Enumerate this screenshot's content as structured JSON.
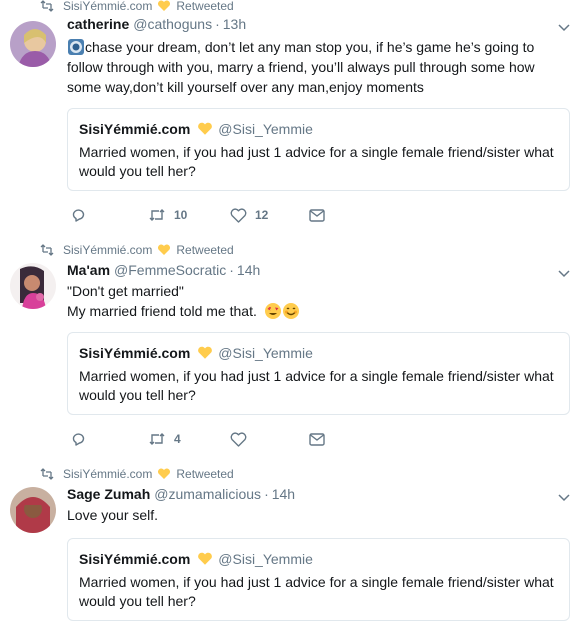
{
  "tweets": [
    {
      "retweeted_by": "SisiYémmié.com",
      "retweeted_label": "Retweeted",
      "name": "catherine",
      "handle": "@cathoguns",
      "time": "13h",
      "text": "chase your dream, don’t let any man stop you, if he’s game he’s going to follow through with you, marry a friend, you’ll always pull through some how some way,don’t kill yourself over any man,enjoy moments",
      "quote": {
        "name": "SisiYémmié.com",
        "handle": "@Sisi_Yemmie",
        "text": "Married women, if you had just 1 advice for a single female friend/sister what would you tell her?"
      },
      "actions": {
        "reply": "",
        "retweets": "10",
        "likes": "12"
      }
    },
    {
      "retweeted_by": "SisiYémmié.com",
      "retweeted_label": "Retweeted",
      "name": "Ma'am",
      "handle": "@FemmeSocratic",
      "time": "14h",
      "text_line1": "\"Don't get married\"",
      "text_line2": "My married friend told me that.",
      "quote": {
        "name": "SisiYémmié.com",
        "handle": "@Sisi_Yemmie",
        "text": "Married women, if you had just 1 advice for a single female friend/sister what would you tell her?"
      },
      "actions": {
        "reply": "",
        "retweets": "4",
        "likes": ""
      }
    },
    {
      "retweeted_by": "SisiYémmié.com",
      "retweeted_label": "Retweeted",
      "name": "Sage Zumah",
      "handle": "@zumamalicious",
      "time": "14h",
      "text": "Love your self.",
      "quote": {
        "name": "SisiYémmié.com",
        "handle": "@Sisi_Yemmie",
        "text": "Married women, if you had just 1 advice for a single female friend/sister what would you tell her?"
      }
    }
  ],
  "colors": {
    "secondary_text": "#657786",
    "primary_text": "#14171a",
    "border": "#e1e8ed",
    "heart_yellow": "#ffcc4d"
  }
}
